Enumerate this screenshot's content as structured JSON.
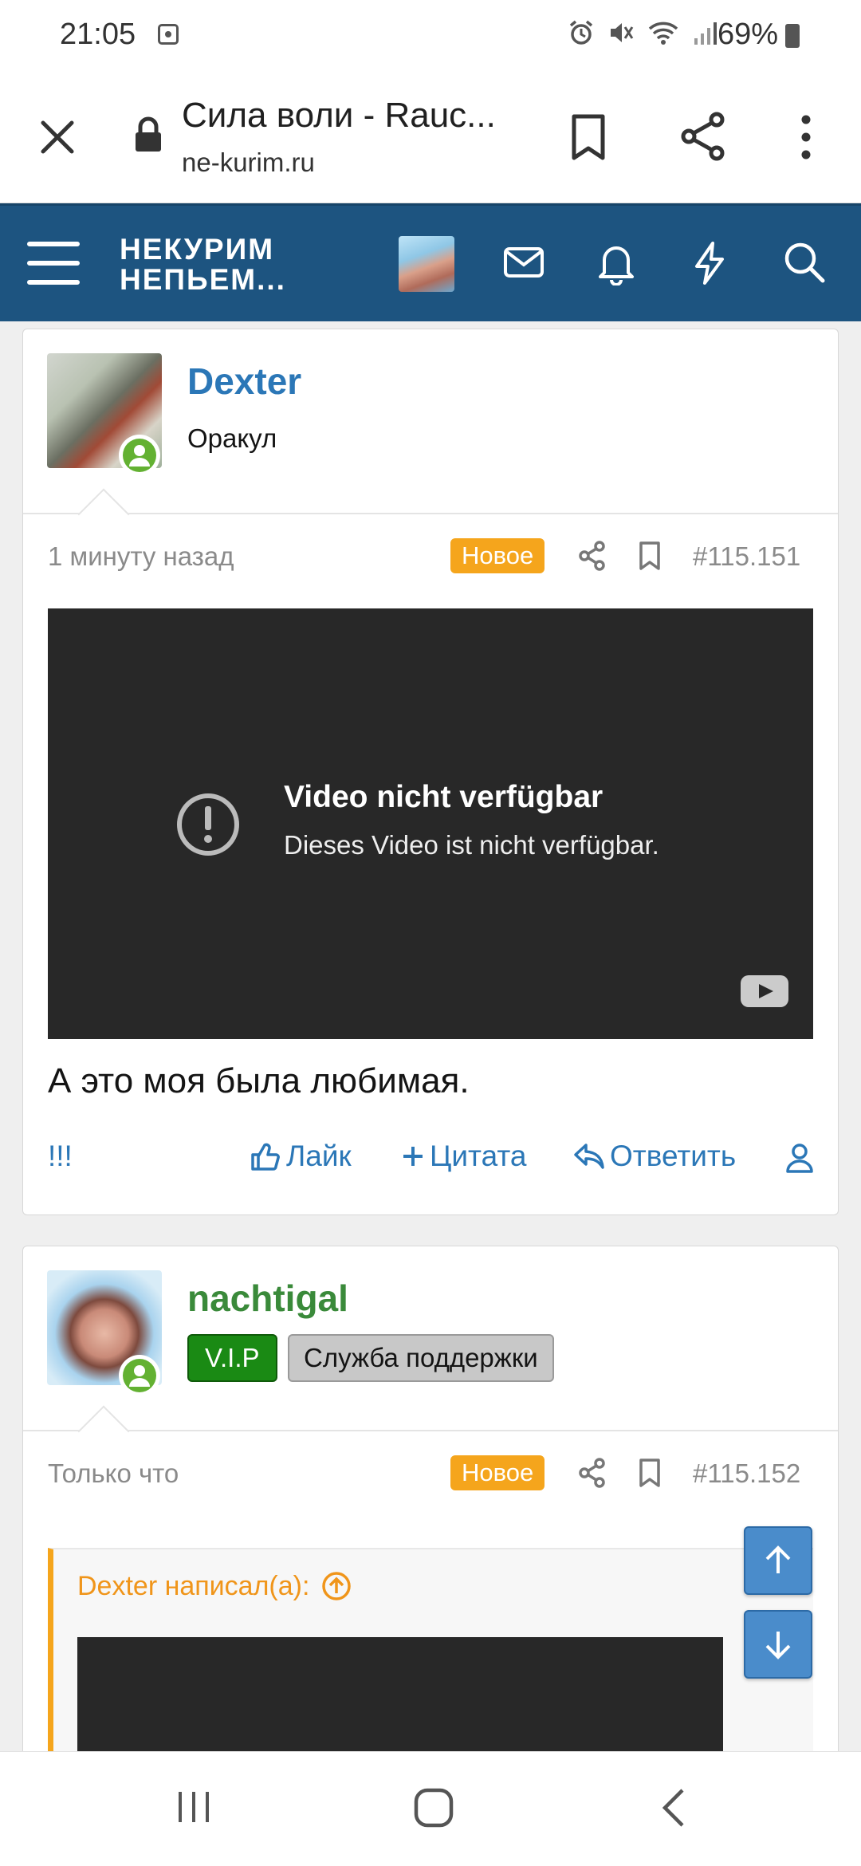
{
  "status_bar": {
    "time": "21:05",
    "battery": "69%"
  },
  "browser": {
    "title": "Сила воли - Rauc...",
    "url": "ne-kurim.ru"
  },
  "forum": {
    "logo_line1": "НЕКУРИМ",
    "logo_line2": "НЕПЬЕМ..."
  },
  "posts": [
    {
      "username": "Dexter",
      "user_title": "Оракул",
      "time": "1 минуту назад",
      "badge": "Новое",
      "number": "#115.151",
      "video_title": "Video nicht verfügbar",
      "video_subtitle": "Dieses Video ist nicht verfügbar.",
      "text": "А это моя была любимая.",
      "actions": {
        "exclaim": "!!!",
        "like": "Лайк",
        "quote": "Цитата",
        "reply": "Ответить"
      }
    },
    {
      "username": "nachtigal",
      "badge_vip": "V.I.P",
      "badge_support": "Служба поддержки",
      "time": "Только что",
      "badge": "Новое",
      "number": "#115.152",
      "quote_author": "Dexter написал(а):"
    }
  ],
  "colors": {
    "header": "#1d5480",
    "link_blue": "#2b77b7",
    "username_green": "#3a8a3a",
    "badge_orange": "#f5a51c",
    "vip_green": "#1a8a14"
  },
  "icons": [
    "close-icon",
    "lock-icon",
    "bookmark-icon",
    "share-icon",
    "more-icon",
    "menu-icon",
    "mail-icon",
    "bell-icon",
    "lightning-icon",
    "search-icon",
    "alert-icon",
    "like-icon",
    "plus-icon",
    "reply-icon",
    "user-icon",
    "arrow-up-icon",
    "arrow-down-icon",
    "recents-icon",
    "home-icon",
    "back-icon"
  ]
}
